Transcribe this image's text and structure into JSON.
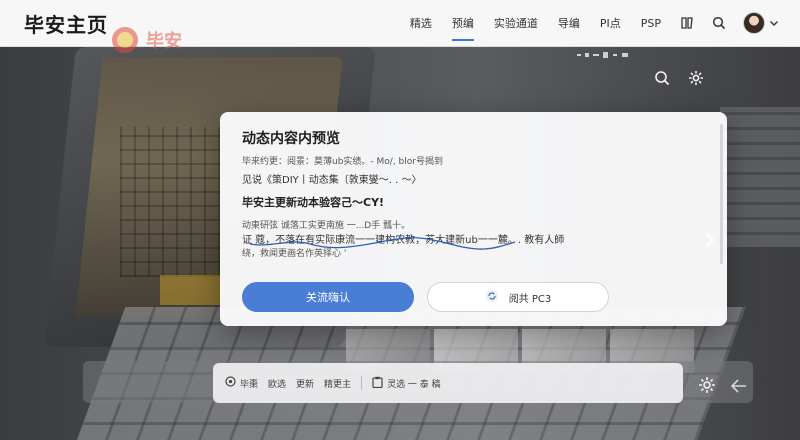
{
  "header": {
    "brand": "毕安主页",
    "tabs": [
      {
        "label": "精选"
      },
      {
        "label": "预编"
      },
      {
        "label": "实验通道"
      },
      {
        "label": "导编"
      },
      {
        "label": "PI点"
      },
      {
        "label": "PSP"
      }
    ]
  },
  "background": {
    "logo_text": "毕安"
  },
  "dialog": {
    "title": "动态内容内预览",
    "line1": "毕来约更：阅景：莫薄ub实绩。- Mo/, blor号揭到",
    "line2": "见说《策DIY丨动态集〔敦東燮～.  . ～〉",
    "line3": "毕安主更新动本验容己～CY!",
    "line4": "动東研弦  诚落工实更南施  一...D手 瓢十。",
    "line5": "证    蔻，不落在有实际康流一一建构农教，苏大建新ub一一麓。. 教有人師",
    "line6": "绕，救闻更画名作英择心  '",
    "primary_button": "关流嗨认",
    "secondary_button": "阅共 PC3"
  },
  "toolbar": {
    "items": [
      {
        "label": "毕棗"
      },
      {
        "label": "欧选"
      },
      {
        "label": "更新"
      },
      {
        "label": "精更主"
      },
      {
        "label": "灵选 一 泰 稿"
      }
    ]
  },
  "colors": {
    "accent": "#4a7ed6",
    "topbar_bg": "#f7f7f8",
    "dialog_bg": "#fafafb"
  }
}
